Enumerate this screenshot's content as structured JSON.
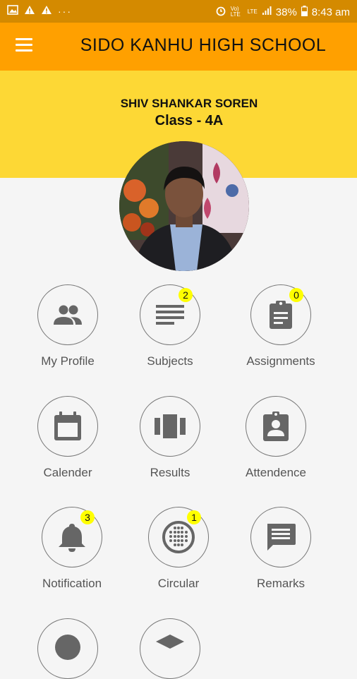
{
  "status_bar": {
    "battery": "38%",
    "time": "8:43 am",
    "network1": "Vo) LTE",
    "network2": "LTE"
  },
  "app_bar": {
    "title": "SIDO KANHU HIGH SCHOOL"
  },
  "profile": {
    "name": "SHIV SHANKAR SOREN",
    "class": "Class - 4A"
  },
  "menu": [
    {
      "label": "My Profile",
      "icon": "people-icon",
      "badge": ""
    },
    {
      "label": "Subjects",
      "icon": "subject-list-icon",
      "badge": "2"
    },
    {
      "label": "Assignments",
      "icon": "clipboard-icon",
      "badge": "0"
    },
    {
      "label": "Calender",
      "icon": "calendar-icon",
      "badge": ""
    },
    {
      "label": "Results",
      "icon": "carousel-icon",
      "badge": ""
    },
    {
      "label": "Attendence",
      "icon": "badge-id-icon",
      "badge": ""
    },
    {
      "label": "Notification",
      "icon": "bell-icon",
      "badge": "3"
    },
    {
      "label": "Circular",
      "icon": "dial-icon",
      "badge": "1"
    },
    {
      "label": "Remarks",
      "icon": "message-icon",
      "badge": ""
    }
  ],
  "colors": {
    "status_bar": "#d48a00",
    "app_bar": "#ffa000",
    "banner": "#fdd835",
    "badge": "#ffff00",
    "icon": "#666666"
  }
}
